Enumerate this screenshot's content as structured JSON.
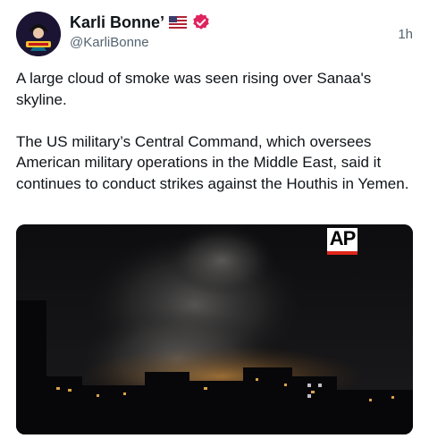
{
  "author": {
    "display_name": "Karli Bonne’",
    "handle": "@KarliBonne",
    "avatar_icon": "avatar-image",
    "flag_icon": "us-flag-icon",
    "verified_icon": "verified-badge-icon",
    "verified_color": "#e0245e"
  },
  "post": {
    "timestamp": "1h",
    "text": "A large cloud of smoke was seen rising over Sanaa's skyline.\n\nThe US military’s Central Command, which oversees American military operations in the Middle East, said it continues to conduct strikes against the Houthis in Yemen."
  },
  "media": {
    "type": "video-still",
    "watermark": "AP",
    "watermark_accent": "#e0261b"
  }
}
